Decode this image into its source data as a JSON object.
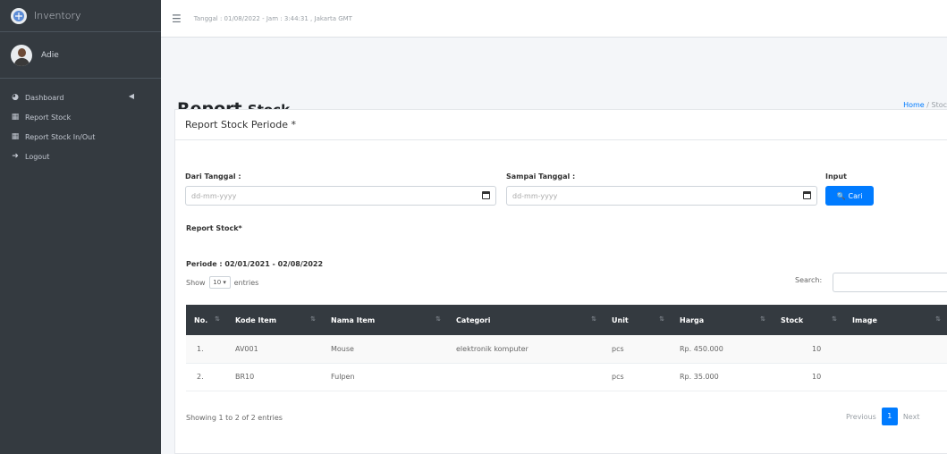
{
  "app": {
    "brand": "Inventory",
    "user": "Adie"
  },
  "sidebar": {
    "items": [
      {
        "label": "Dashboard",
        "icon": "dashboard-icon"
      },
      {
        "label": "Report Stock",
        "icon": "table-icon"
      },
      {
        "label": "Report Stock In/Out",
        "icon": "table-icon"
      },
      {
        "label": "Logout",
        "icon": "logout-icon"
      }
    ]
  },
  "topbar": {
    "info": "Tanggal : 01/08/2022 - Jam : 3:44:31 , Jakarta GMT"
  },
  "header": {
    "title_first": "Report",
    "title_second": "Stock",
    "breadcrumb_home": "Home",
    "breadcrumb_sep": "/",
    "breadcrumb_current": "Stoc"
  },
  "card": {
    "title": "Report Stock Periode *"
  },
  "filters": {
    "from_label": "Dari Tanggal :",
    "from_placeholder": "dd-mm-yyyy",
    "to_label": "Sampai Tanggal :",
    "to_placeholder": "dd-mm-yyyy",
    "input_label": "Input",
    "search_button": "Cari"
  },
  "report": {
    "title": "Report Stock*",
    "period": "Periode : 02/01/2021 - 02/08/2022",
    "show_label": "Show",
    "entries_value": "10",
    "entries_label": "entries",
    "search_label": "Search:"
  },
  "table": {
    "columns": [
      "No.",
      "Kode Item",
      "Nama Item",
      "Categori",
      "Unit",
      "Harga",
      "Stock",
      "Image"
    ],
    "rows": [
      {
        "no": "1.",
        "kode": "AV001",
        "nama": "Mouse",
        "categori": "elektronik komputer",
        "unit": "pcs",
        "harga": "Rp. 450.000",
        "stock": "10",
        "image": ""
      },
      {
        "no": "2.",
        "kode": "BR10",
        "nama": "Fulpen",
        "categori": "",
        "unit": "pcs",
        "harga": "Rp. 35.000",
        "stock": "10",
        "image": ""
      }
    ]
  },
  "footer": {
    "info": "Showing 1 to 2 of 2 entries",
    "previous": "Previous",
    "page": "1",
    "next": "Next"
  },
  "colors": {
    "sidebar_bg": "#343a40",
    "accent": "#007bff",
    "table_header_bg": "#343a40"
  }
}
